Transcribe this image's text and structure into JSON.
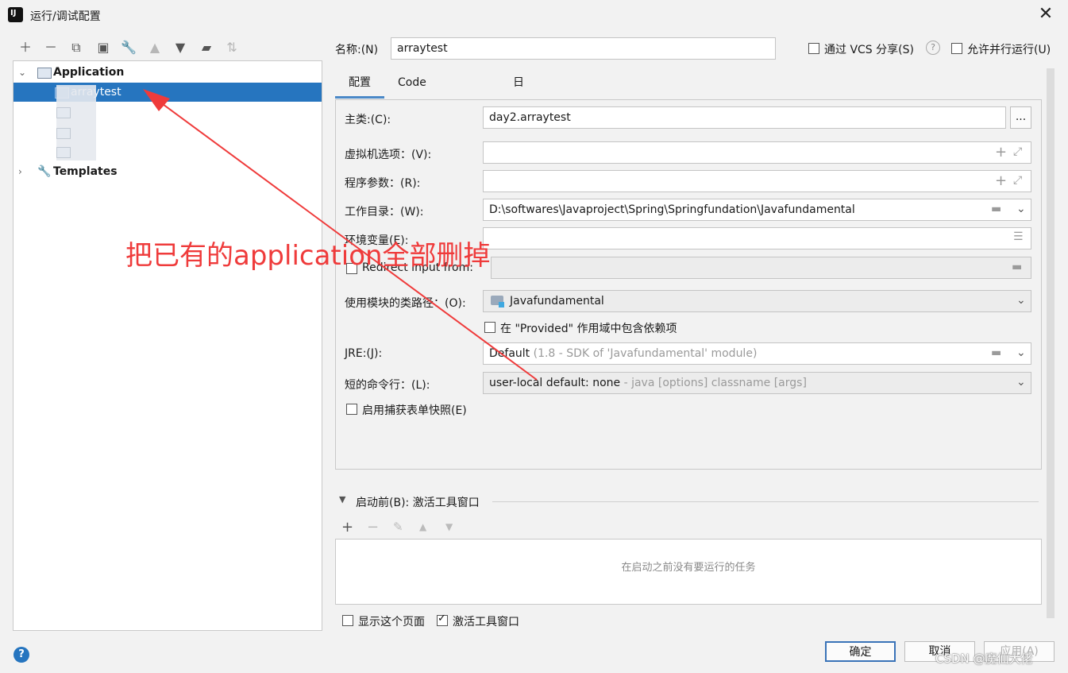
{
  "window": {
    "title": "运行/调试配置"
  },
  "tree": {
    "group_application": "Application",
    "selected_item": "arraytest",
    "group_templates": "Templates"
  },
  "form": {
    "name_label": "名称:(N)",
    "name_value": "arraytest",
    "share_vcs": "通过 VCS 分享(S)",
    "allow_parallel": "允许并行运行(U)",
    "tabs": [
      "配置",
      "Code Coverage",
      "日志"
    ],
    "main_class_label": "主类:(C):",
    "main_class_value": "day2.arraytest",
    "browse_label": "...",
    "vm_options_label": "虚拟机选项：(V):",
    "program_args_label": "程序参数：(R):",
    "working_dir_label": "工作目录：(W):",
    "working_dir_value": "D:\\softwares\\Javaproject\\Spring\\Springfundation\\Javafundamental",
    "env_vars_label": "环境变量(E):",
    "redirect_input_label": "Redirect input from:",
    "module_classpath_label": "使用模块的类路径：(O):",
    "module_classpath_value": "Javafundamental",
    "include_provided_label": "在 \"Provided\" 作用域中包含依赖项",
    "jre_label": "JRE:(J):",
    "jre_value": "Default",
    "jre_hint": "(1.8 - SDK of 'Javafundamental' module)",
    "shorten_cmd_label": "短的命令行：(L):",
    "shorten_cmd_value": "user-local default: none",
    "shorten_cmd_hint": "- java [options] classname [args]",
    "capture_snapshots_label": "启用捕获表单快照(E)"
  },
  "before_launch": {
    "header": "启动前(B): 激活工具窗口",
    "empty_text": "在启动之前没有要运行的任务",
    "show_page_label": "显示这个页面",
    "activate_window_label": "激活工具窗口"
  },
  "buttons": {
    "ok": "确定",
    "cancel": "取消",
    "apply": "应用(A)"
  },
  "annotation": "把已有的application全部删掉",
  "watermark": "CSDN @魔仙大佬",
  "colors": {
    "selection": "#2675bf",
    "annotation": "#ef3b3b"
  }
}
